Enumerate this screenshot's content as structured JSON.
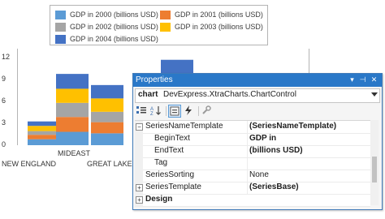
{
  "legend": [
    {
      "label": "GDP in 2000 (billions USD)",
      "color": "#5b9bd5"
    },
    {
      "label": "GDP in 2001 (billions USD)",
      "color": "#ed7d31"
    },
    {
      "label": "GDP in 2002 (billions USD)",
      "color": "#a5a5a5"
    },
    {
      "label": "GDP in 2003 (billions USD)",
      "color": "#ffc000"
    },
    {
      "label": "GDP in 2004 (billions USD)",
      "color": "#4472c4"
    }
  ],
  "chart_data": {
    "type": "bar",
    "stacked": true,
    "categories": [
      "NEW ENGLAND",
      "MIDEAST",
      "GREAT LAKES",
      ""
    ],
    "series": [
      {
        "name": "GDP in 2000 (billions USD)",
        "values": [
          0.8,
          1.8,
          1.6,
          1.9
        ]
      },
      {
        "name": "GDP in 2001 (billions USD)",
        "values": [
          0.6,
          2.0,
          1.5,
          2.1
        ]
      },
      {
        "name": "GDP in 2002 (billions USD)",
        "values": [
          0.5,
          1.9,
          1.4,
          2.2
        ]
      },
      {
        "name": "GDP in 2003 (billions USD)",
        "values": [
          0.7,
          1.9,
          1.8,
          2.1
        ]
      },
      {
        "name": "GDP in 2004 (billions USD)",
        "values": [
          0.6,
          2.0,
          1.8,
          3.2
        ]
      }
    ],
    "y_ticks": [
      "0",
      "3",
      "6",
      "9",
      "12"
    ],
    "ylim": [
      0,
      13
    ],
    "grid": false,
    "legend_position": "top"
  },
  "properties": {
    "title": "Properties",
    "object_name": "chart",
    "object_type": "DevExpress.XtraCharts.ChartControl",
    "rows": [
      {
        "name": "SeriesNameTemplate",
        "value": "(SeriesNameTemplate)",
        "bold_value": true,
        "expander": "minus",
        "indent": false
      },
      {
        "name": "BeginText",
        "value": "GDP in",
        "bold_value": true,
        "expander": "",
        "indent": true
      },
      {
        "name": "EndText",
        "value": " (billions USD)",
        "bold_value": true,
        "expander": "",
        "indent": true
      },
      {
        "name": "Tag",
        "value": "",
        "bold_value": false,
        "expander": "",
        "indent": true
      },
      {
        "name": "SeriesSorting",
        "value": "None",
        "bold_value": false,
        "expander": "",
        "indent": false
      },
      {
        "name": "SeriesTemplate",
        "value": "(SeriesBase)",
        "bold_value": true,
        "expander": "plus",
        "indent": false
      },
      {
        "name": "Design",
        "value": "",
        "bold_value": false,
        "expander": "plus",
        "indent": false,
        "category": true
      }
    ]
  }
}
